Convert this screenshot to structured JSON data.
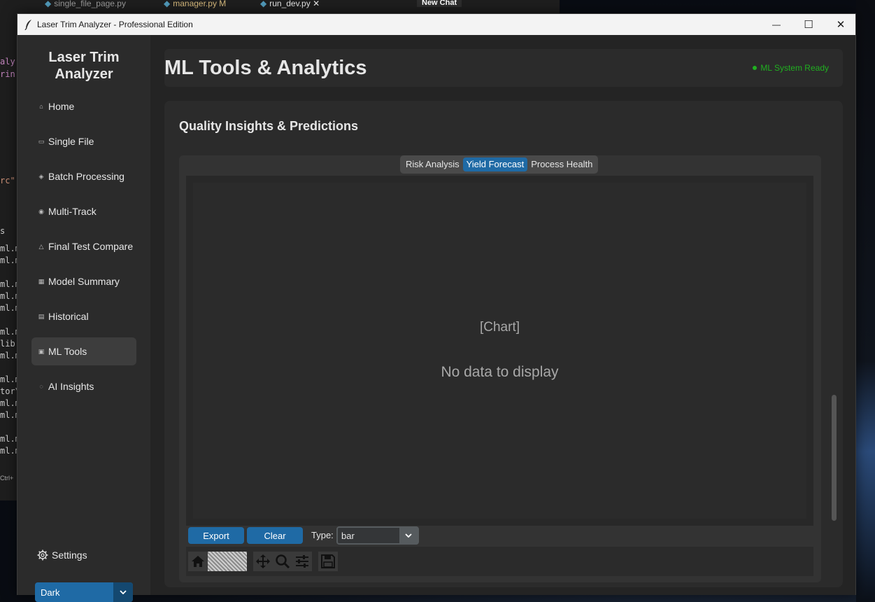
{
  "background_editor": {
    "tabs": [
      "single_file_page.py",
      "manager.py",
      "M",
      "run_dev.py",
      "New Chat"
    ],
    "code_fragments": [
      "aly",
      "rin",
      "rc\"",
      "s",
      "ml.m",
      "ml.m",
      "ml.m",
      "ml.m",
      "ml.m",
      "ml.m",
      "lib",
      "ml.m",
      "ml.m",
      "tor\\",
      "ml.m",
      "ml.m",
      "ml.m",
      "ml.m",
      "Ctrl+"
    ]
  },
  "window": {
    "title": "Laser Trim Analyzer - Professional Edition",
    "minimize_glyph": "—",
    "maximize_glyph": "☐",
    "close_glyph": "✕"
  },
  "sidebar": {
    "app_title_line1": "Laser Trim",
    "app_title_line2": "Analyzer",
    "items": [
      {
        "label": "Home",
        "icon": "home-icon",
        "glyph": "⌂"
      },
      {
        "label": "Single File",
        "icon": "document-icon",
        "glyph": "▭"
      },
      {
        "label": "Batch Processing",
        "icon": "package-icon",
        "glyph": "◈"
      },
      {
        "label": "Multi-Track",
        "icon": "target-icon",
        "glyph": "◉"
      },
      {
        "label": "Final Test Compare",
        "icon": "scale-icon",
        "glyph": "△"
      },
      {
        "label": "Model Summary",
        "icon": "chart-icon",
        "glyph": "▦"
      },
      {
        "label": "Historical",
        "icon": "scroll-icon",
        "glyph": "▤"
      },
      {
        "label": "ML Tools",
        "icon": "robot-icon",
        "glyph": "▣"
      },
      {
        "label": "AI Insights",
        "icon": "lightbulb-icon",
        "glyph": "◌"
      }
    ],
    "active_index": 7,
    "settings_label": "Settings",
    "theme": {
      "selected": "Dark"
    }
  },
  "header": {
    "title": "ML Tools & Analytics",
    "status": "ML System Ready"
  },
  "panel": {
    "title": "Quality Insights & Predictions",
    "tabs": [
      "Risk Analysis",
      "Yield Forecast",
      "Process Health"
    ],
    "active_tab": 1,
    "chart_placeholder": "[Chart]",
    "chart_message": "No data to display",
    "export_label": "Export",
    "clear_label": "Clear",
    "type_label": "Type:",
    "type_value": "bar"
  },
  "colors": {
    "accent": "#1f6aa5",
    "status_ok": "#20b020",
    "window_bg": "#202020",
    "sidebar_bg": "#2b2b2b"
  }
}
